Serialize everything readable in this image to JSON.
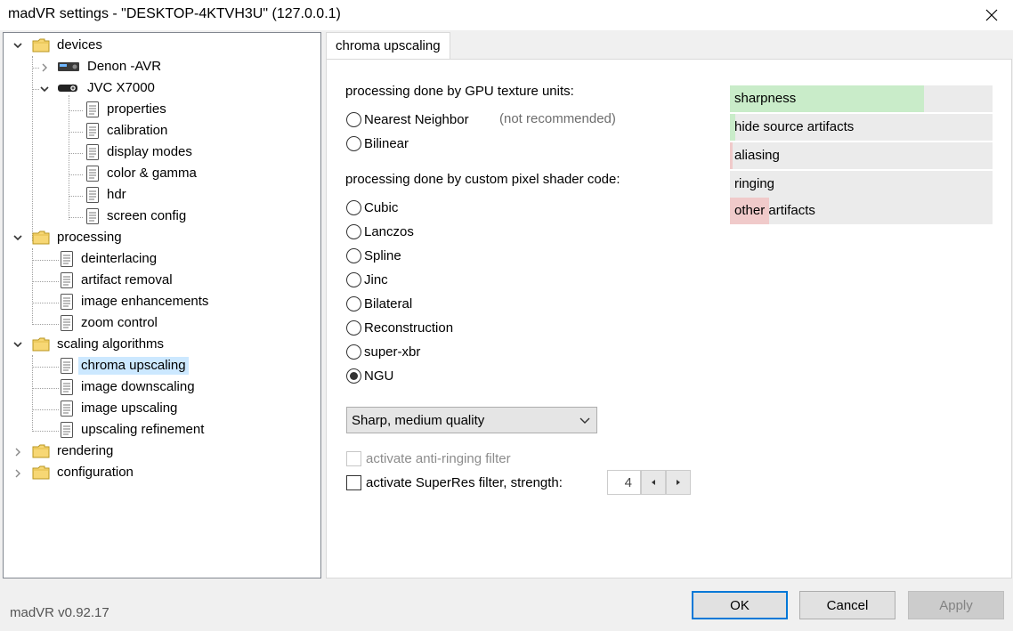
{
  "window": {
    "title": "madVR settings - \"DESKTOP-4KTVH3U\" (127.0.0.1)"
  },
  "tree": {
    "devices": "devices",
    "denon": "Denon -AVR",
    "jvc": "JVC X7000",
    "properties": "properties",
    "calibration": "calibration",
    "display_modes": "display modes",
    "color_gamma": "color & gamma",
    "hdr": "hdr",
    "screen_config": "screen config",
    "processing": "processing",
    "deinterlacing": "deinterlacing",
    "artifact_removal": "artifact removal",
    "image_enhancements": "image enhancements",
    "zoom_control": "zoom control",
    "scaling_algorithms": "scaling algorithms",
    "chroma_upscaling": "chroma upscaling",
    "image_downscaling": "image downscaling",
    "image_upscaling": "image upscaling",
    "upscaling_refinement": "upscaling refinement",
    "rendering": "rendering",
    "configuration": "configuration"
  },
  "tab": {
    "label": "chroma upscaling"
  },
  "section_gpu": {
    "label": "processing done by GPU texture units:"
  },
  "radios_gpu": [
    {
      "label": "Nearest Neighbor",
      "note": "(not recommended)"
    },
    {
      "label": "Bilinear"
    }
  ],
  "section_shader": {
    "label": "processing done by custom pixel shader code:"
  },
  "radios_shader": [
    {
      "label": "Cubic"
    },
    {
      "label": "Lanczos"
    },
    {
      "label": "Spline"
    },
    {
      "label": "Jinc"
    },
    {
      "label": "Bilateral"
    },
    {
      "label": "Reconstruction"
    },
    {
      "label": "super-xbr"
    },
    {
      "label": "NGU",
      "selected": true
    }
  ],
  "quality_select": {
    "value": "Sharp, medium quality"
  },
  "anti_ringing": {
    "label": "activate anti-ringing filter",
    "enabled": false,
    "checked": false
  },
  "superres": {
    "label": "activate SuperRes filter, strength:",
    "checked": false,
    "strength": "4"
  },
  "quality_meter": [
    {
      "label": "sharpness",
      "level": 0.74,
      "color": "#c9ecc9"
    },
    {
      "label": "hide source artifacts",
      "level": 0.02,
      "color": "#c9ecc9"
    },
    {
      "label": "aliasing",
      "level": 0.01,
      "color": "#f0caca"
    },
    {
      "label": "ringing",
      "level": 0,
      "color": "#f0caca"
    },
    {
      "label": "other artifacts",
      "level": 0.15,
      "color": "#f0caca"
    }
  ],
  "footer": {
    "version": "madVR v0.92.17",
    "ok": "OK",
    "cancel": "Cancel",
    "apply": "Apply"
  },
  "colors": {
    "selection": "#cce8ff",
    "default_button_border": "#0078d7"
  }
}
